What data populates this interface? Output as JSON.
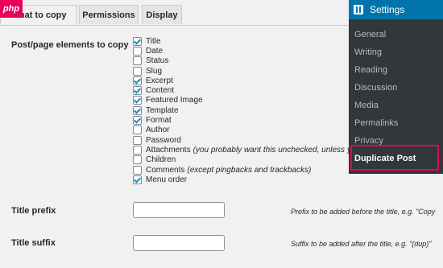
{
  "watermark": "php",
  "tabs": [
    {
      "label": "What to copy",
      "active": true
    },
    {
      "label": "Permissions",
      "active": false
    },
    {
      "label": "Display",
      "active": false
    }
  ],
  "elements_section": {
    "label": "Post/page elements to copy",
    "items": [
      {
        "label": "Title",
        "checked": true,
        "hint": ""
      },
      {
        "label": "Date",
        "checked": false,
        "hint": ""
      },
      {
        "label": "Status",
        "checked": false,
        "hint": ""
      },
      {
        "label": "Slug",
        "checked": false,
        "hint": ""
      },
      {
        "label": "Excerpt",
        "checked": true,
        "hint": ""
      },
      {
        "label": "Content",
        "checked": true,
        "hint": ""
      },
      {
        "label": "Featured Image",
        "checked": true,
        "hint": ""
      },
      {
        "label": "Template",
        "checked": true,
        "hint": ""
      },
      {
        "label": "Format",
        "checked": true,
        "hint": ""
      },
      {
        "label": "Author",
        "checked": false,
        "hint": ""
      },
      {
        "label": "Password",
        "checked": false,
        "hint": ""
      },
      {
        "label": "Attachments",
        "checked": false,
        "hint": "(you probably want this unchecked, unless you"
      },
      {
        "label": "Children",
        "checked": false,
        "hint": ""
      },
      {
        "label": "Comments",
        "checked": false,
        "hint": "(except pingbacks and trackbacks)"
      },
      {
        "label": "Menu order",
        "checked": true,
        "hint": ""
      }
    ]
  },
  "title_prefix": {
    "label": "Title prefix",
    "value": "",
    "hint": "Prefix to be added before the title, e.g. \"Copy"
  },
  "title_suffix": {
    "label": "Title suffix",
    "value": "",
    "hint": "Suffix to be added after the title, e.g. \"(dup)\""
  },
  "settings_menu": {
    "title": "Settings",
    "items": [
      {
        "label": "General",
        "current": false
      },
      {
        "label": "Writing",
        "current": false
      },
      {
        "label": "Reading",
        "current": false
      },
      {
        "label": "Discussion",
        "current": false
      },
      {
        "label": "Media",
        "current": false
      },
      {
        "label": "Permalinks",
        "current": false
      },
      {
        "label": "Privacy",
        "current": false
      },
      {
        "label": "Duplicate Post",
        "current": true
      }
    ]
  },
  "colors": {
    "page_bg": "#f1f1f1",
    "menu_bg": "#32373c",
    "menu_header_bg": "#0073aa",
    "highlight_border": "#e8005a",
    "checkbox_check": "#1e8cbe"
  }
}
